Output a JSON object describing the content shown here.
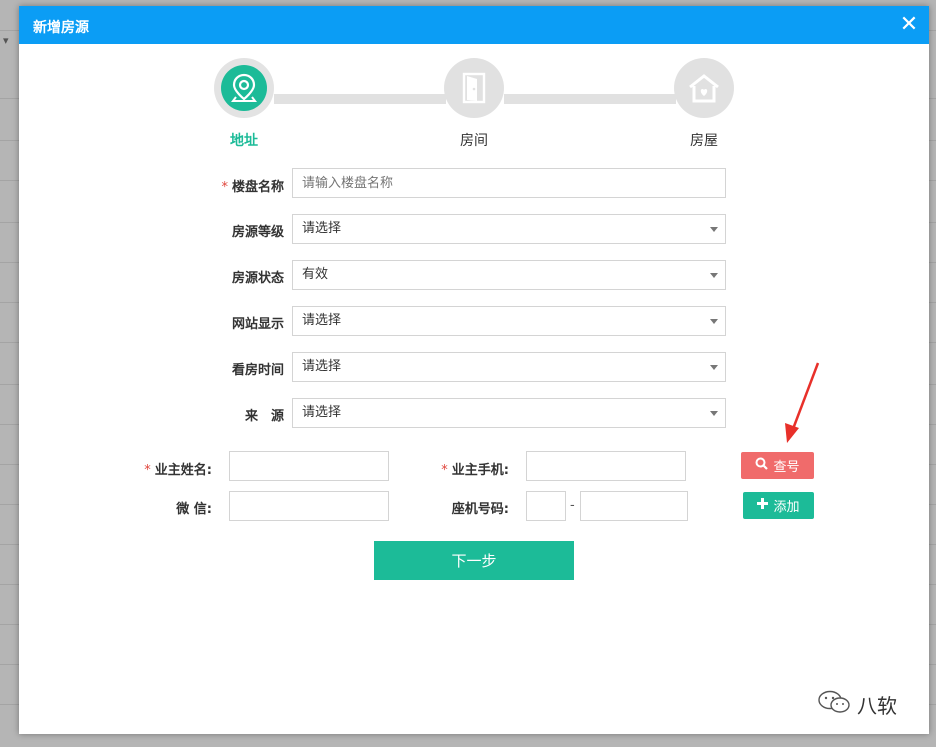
{
  "dialog": {
    "title": "新增房源",
    "close_symbol": "✕"
  },
  "steps": [
    {
      "label": "地址",
      "icon": "location-icon",
      "active": true
    },
    {
      "label": "房间",
      "icon": "door-icon",
      "active": false
    },
    {
      "label": "房屋",
      "icon": "house-icon",
      "active": false
    }
  ],
  "form": {
    "required_mark": "*",
    "building_name": {
      "label": "楼盘名称",
      "placeholder": "请输入楼盘名称",
      "value": ""
    },
    "listing_grade": {
      "label": "房源等级",
      "value": "请选择"
    },
    "listing_status": {
      "label": "房源状态",
      "value": "有效"
    },
    "website_display": {
      "label": "网站显示",
      "value": "请选择"
    },
    "viewing_time": {
      "label": "看房时间",
      "value": "请选择"
    },
    "source": {
      "label": "来　源",
      "value": "请选择"
    },
    "owner_name": {
      "label": "业主姓名:",
      "value": ""
    },
    "owner_mobile": {
      "label": "业主手机:",
      "value": ""
    },
    "wechat": {
      "label": "微 信:",
      "value": ""
    },
    "landline": {
      "label": "座机号码:",
      "separator": "-",
      "area_code": "",
      "number": ""
    }
  },
  "buttons": {
    "lookup": "查号",
    "add": "添加",
    "next": "下一步"
  },
  "watermark": {
    "text": "八软",
    "icon": "wechat-icon"
  },
  "colors": {
    "header": "#0b9df5",
    "accent": "#1cbb98",
    "danger": "#f06b6b",
    "arrow": "#e8302a"
  }
}
